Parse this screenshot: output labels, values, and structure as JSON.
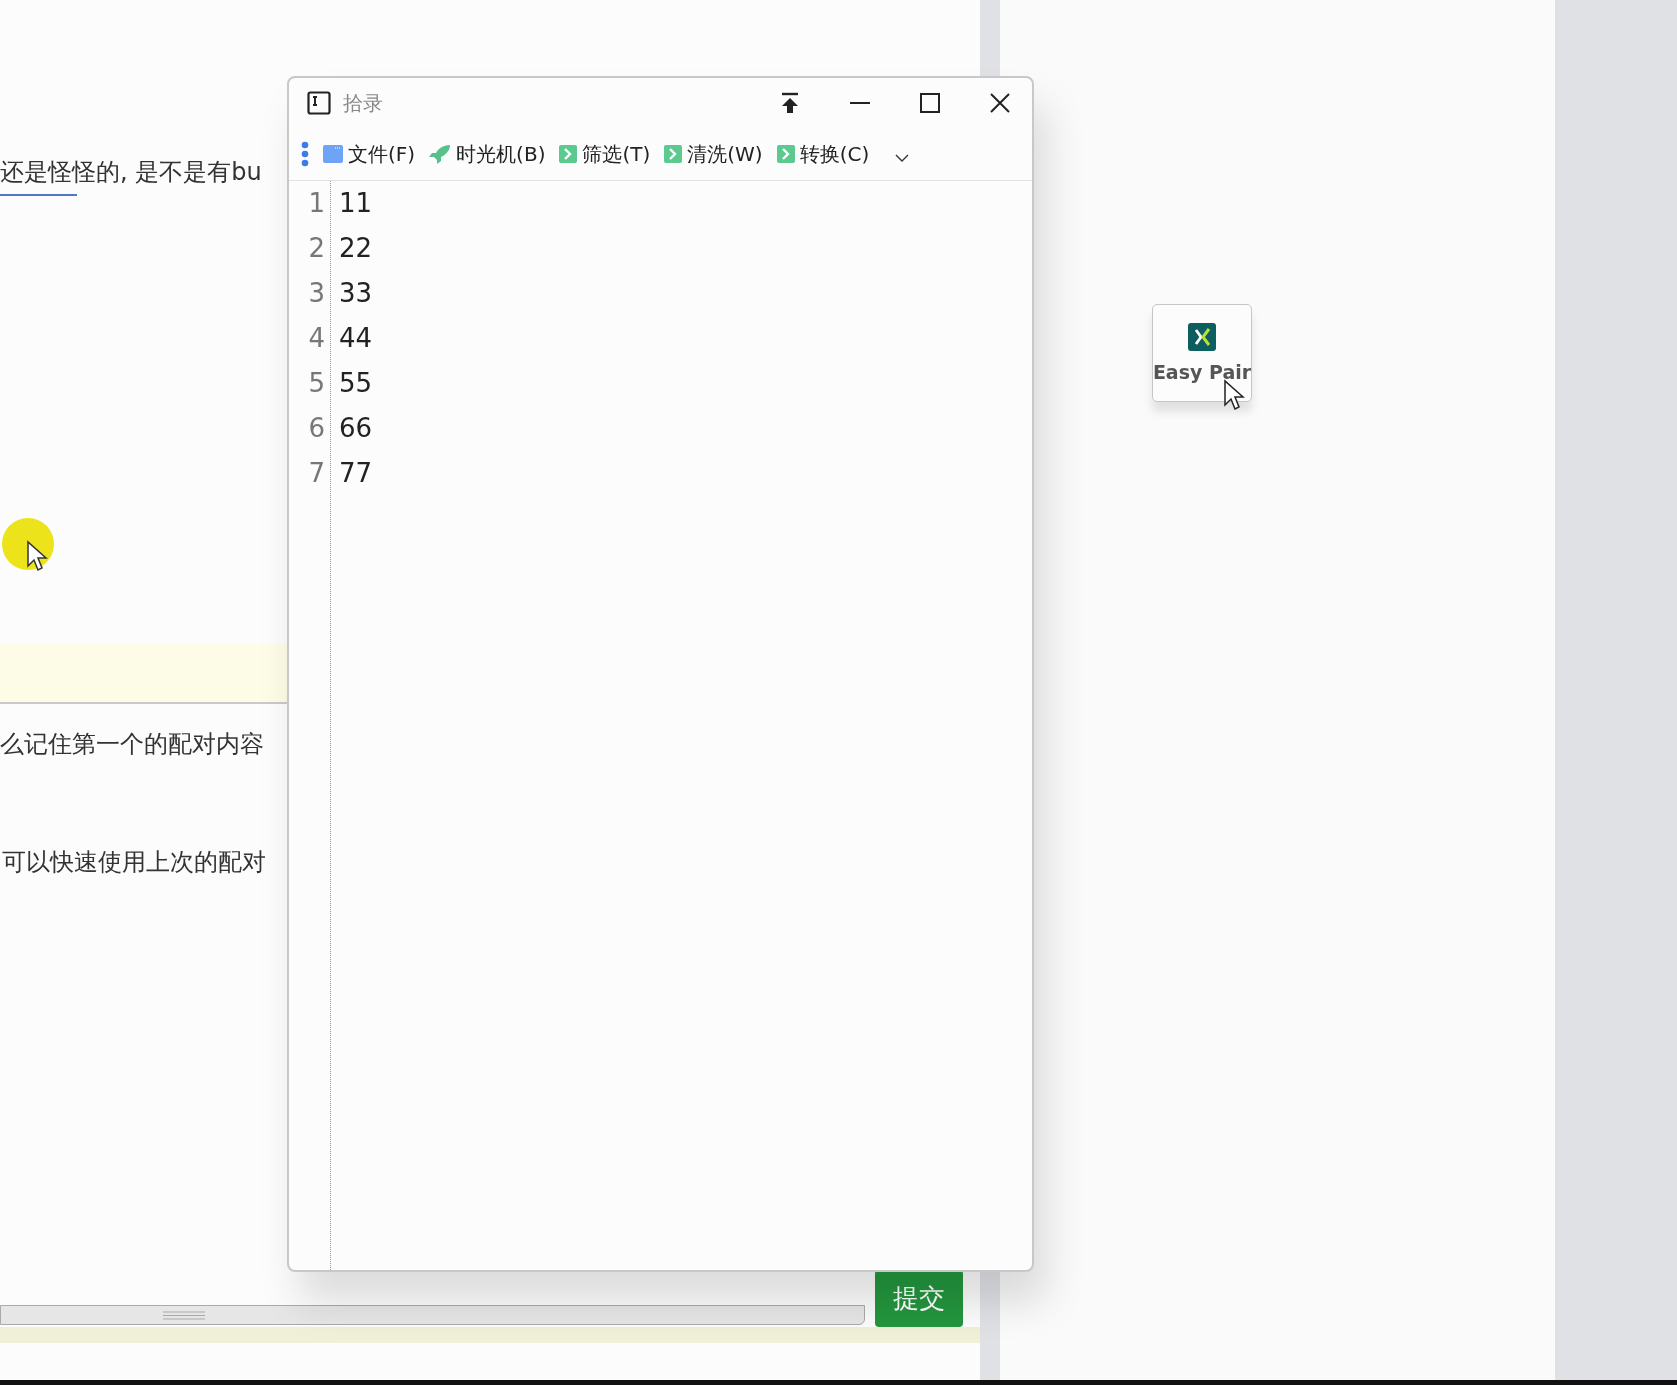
{
  "background_page": {
    "lines": [
      "还是怪怪的, 是不是有bu",
      "么记住第一个的配对内容",
      "可以快速使用上次的配对"
    ],
    "submit_button": "提交"
  },
  "window": {
    "title": "拾录",
    "toolbar": [
      {
        "label": "文件(F)",
        "kind": "folder"
      },
      {
        "label": "时光机(B)",
        "kind": "rocket"
      },
      {
        "label": "筛选(T)",
        "kind": "arrow"
      },
      {
        "label": "清洗(W)",
        "kind": "arrow"
      },
      {
        "label": "转换(C)",
        "kind": "arrow"
      }
    ],
    "editor": {
      "lines": [
        {
          "number": "1",
          "text": "11"
        },
        {
          "number": "2",
          "text": "22"
        },
        {
          "number": "3",
          "text": "33"
        },
        {
          "number": "4",
          "text": "44"
        },
        {
          "number": "5",
          "text": "55"
        },
        {
          "number": "6",
          "text": "66"
        },
        {
          "number": "7",
          "text": "77"
        }
      ]
    }
  },
  "widget": {
    "label": "Easy Pair"
  }
}
